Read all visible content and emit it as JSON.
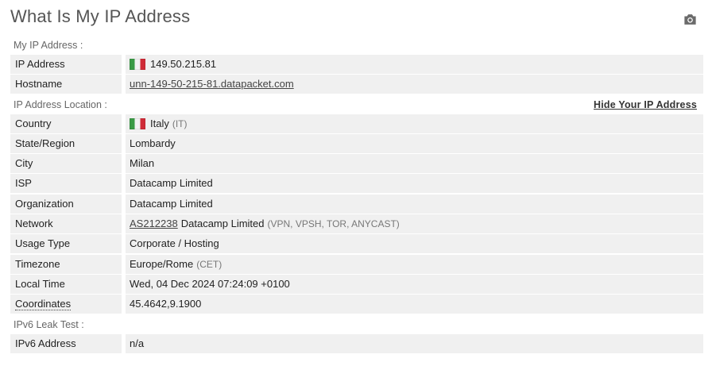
{
  "page_title": "What Is My IP Address",
  "camera_icon": "camera-icon",
  "my_ip": {
    "section_label": "My IP Address :",
    "rows": [
      {
        "label": "IP Address",
        "value": "149.50.215.81",
        "flag": "italy-flag"
      },
      {
        "label": "Hostname",
        "value": "unn-149-50-215-81.datapacket.com"
      }
    ]
  },
  "location": {
    "section_label": "IP Address Location :",
    "hide_link": "Hide Your IP Address",
    "country": {
      "label": "Country",
      "value": "Italy",
      "code": "(IT)"
    },
    "state": {
      "label": "State/Region",
      "value": "Lombardy"
    },
    "city": {
      "label": "City",
      "value": "Milan"
    },
    "isp": {
      "label": "ISP",
      "value": "Datacamp Limited"
    },
    "organization": {
      "label": "Organization",
      "value": "Datacamp Limited"
    },
    "network": {
      "label": "Network",
      "as_link": "AS212238",
      "name": "Datacamp Limited",
      "tags": "(VPN, VPSH, TOR, ANYCAST)"
    },
    "usage": {
      "label": "Usage Type",
      "value": "Corporate / Hosting"
    },
    "timezone": {
      "label": "Timezone",
      "value": "Europe/Rome",
      "abbr": "(CET)"
    },
    "local_time": {
      "label": "Local Time",
      "value": "Wed, 04 Dec 2024 07:24:09 +0100"
    },
    "coordinates": {
      "label": "Coordinates",
      "value": "45.4642,9.1900"
    }
  },
  "ipv6": {
    "section_label": "IPv6 Leak Test :",
    "label": "IPv6 Address",
    "value": "n/a"
  }
}
